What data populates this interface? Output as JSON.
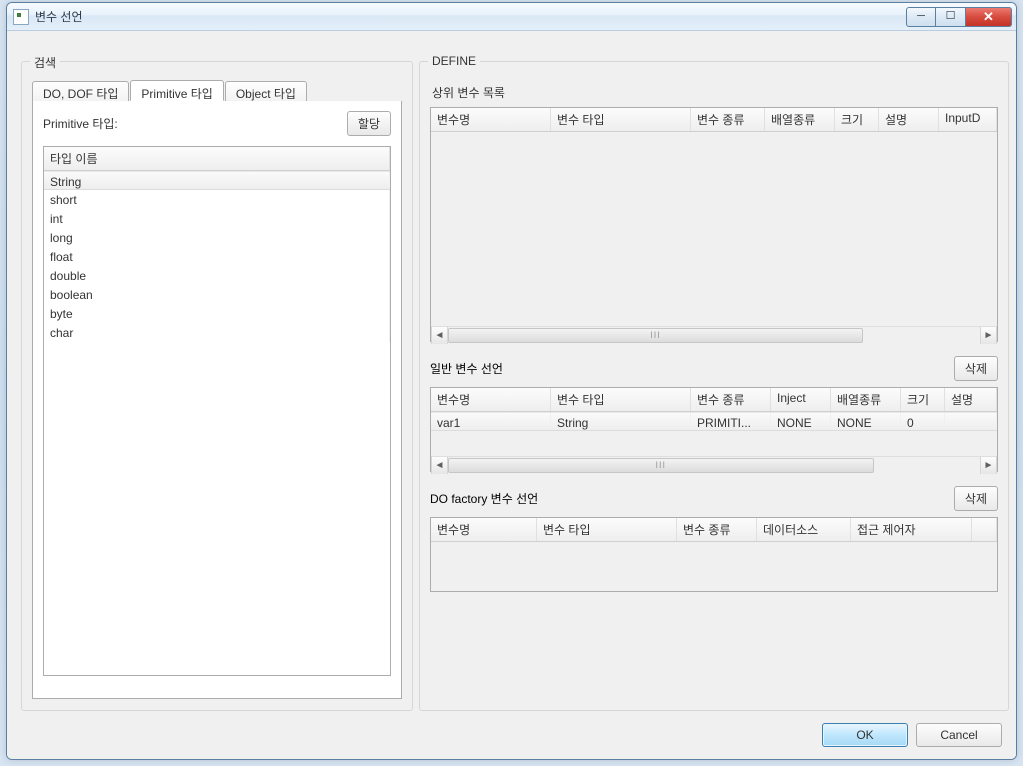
{
  "titlebar": {
    "title": "변수 선언"
  },
  "win": {
    "min": "─",
    "max": "☐",
    "close": "✕"
  },
  "search": {
    "legend": "검색",
    "tabs": [
      "DO, DOF 타입",
      "Primitive 타입",
      "Object 타입"
    ],
    "activeTab": 1,
    "primitive": {
      "label": "Primitive 타입:",
      "assignBtn": "할당",
      "header": "타입 이름",
      "types": [
        "String",
        "short",
        "int",
        "long",
        "float",
        "double",
        "boolean",
        "byte",
        "char"
      ],
      "selectedIndex": 0
    }
  },
  "define": {
    "legend": "DEFINE",
    "upper": {
      "label": "상위 변수 목록",
      "columns": [
        "변수명",
        "변수 타입",
        "변수 종류",
        "배열종류",
        "크기",
        "설명",
        "InputD"
      ],
      "scrollGrip": "III"
    },
    "general": {
      "label": "일반 변수 선언",
      "deleteBtn": "삭제",
      "columns": [
        "변수명",
        "변수 타입",
        "변수 종류",
        "Inject",
        "배열종류",
        "크기",
        "설명"
      ],
      "rows": [
        {
          "name": "var1",
          "type": "String",
          "kind": "PRIMITI...",
          "inject": "NONE",
          "arrayType": "NONE",
          "size": "0",
          "desc": ""
        }
      ],
      "scrollGrip": "III"
    },
    "factory": {
      "label": "DO factory 변수 선언",
      "deleteBtn": "삭제",
      "columns": [
        "변수명",
        "변수 타입",
        "변수 종류",
        "데이터소스",
        "접근 제어자",
        ""
      ]
    }
  },
  "dialog": {
    "ok": "OK",
    "cancel": "Cancel"
  }
}
